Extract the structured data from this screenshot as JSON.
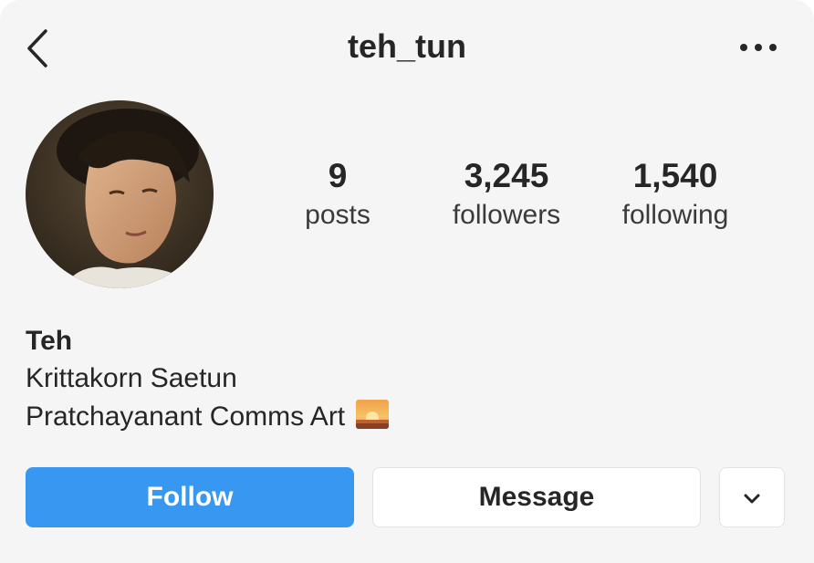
{
  "header": {
    "username": "teh_tun",
    "back_icon": "chevron-left-icon",
    "more_icon": "more-horizontal-icon"
  },
  "stats": {
    "posts": {
      "value": "9",
      "label": "posts"
    },
    "followers": {
      "value": "3,245",
      "label": "followers"
    },
    "following": {
      "value": "1,540",
      "label": "following"
    }
  },
  "bio": {
    "name": "Teh",
    "line1": "Krittakorn Saetun",
    "line2": "Pratchayanant Comms Art",
    "emoji_icon": "sunset-emoji-icon"
  },
  "actions": {
    "follow_label": "Follow",
    "message_label": "Message",
    "dropdown_icon": "chevron-down-icon"
  },
  "colors": {
    "follow_blue": "#3897f0",
    "background": "#f5f5f5",
    "text": "#262626"
  }
}
